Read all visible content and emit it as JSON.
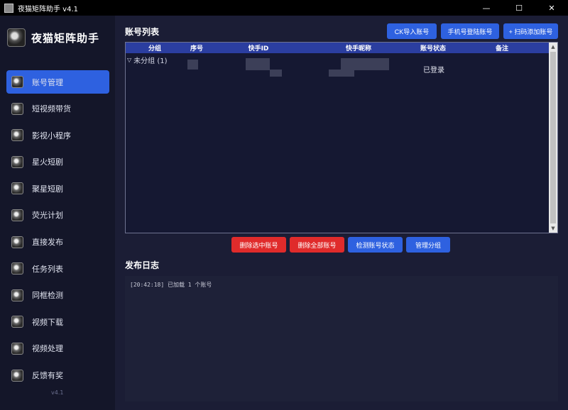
{
  "window": {
    "title": "夜猫矩阵助手 v4.1",
    "controls": {
      "minimize": "—",
      "maximize": "☐",
      "close": "✕"
    }
  },
  "sidebar": {
    "brand": "夜猫矩阵助手",
    "version": "v4.1",
    "items": [
      {
        "label": "账号管理",
        "active": true
      },
      {
        "label": "短视频带货"
      },
      {
        "label": "影视小程序"
      },
      {
        "label": "星火短剧"
      },
      {
        "label": "聚星短剧"
      },
      {
        "label": "荧光计划"
      },
      {
        "label": "直接发布"
      },
      {
        "label": "任务列表"
      },
      {
        "label": "同框检测"
      },
      {
        "label": "视频下载"
      },
      {
        "label": "视频处理"
      },
      {
        "label": "反馈有奖"
      }
    ]
  },
  "accounts": {
    "title": "账号列表",
    "buttons": {
      "ck_import": "CK导入账号",
      "phone_login": "手机号登陆账号",
      "scan_add": "+ 扫码添加账号"
    },
    "columns": [
      "分组",
      "序号",
      "快手ID",
      "快手昵称",
      "账号状态",
      "备注"
    ],
    "group": {
      "label": "未分组 (1)"
    },
    "rows": [
      {
        "status": "已登录"
      }
    ],
    "actions": {
      "delete_selected": "删除选中账号",
      "delete_all": "删除全部账号",
      "check_status": "检测账号状态",
      "manage_groups": "管理分组"
    }
  },
  "log": {
    "title": "发布日志",
    "lines": [
      "[20:42:18] 已加载 1 个账号"
    ]
  },
  "colors": {
    "accent": "#2e61e0",
    "danger": "#e02b2b",
    "header": "#2b3ea0"
  }
}
